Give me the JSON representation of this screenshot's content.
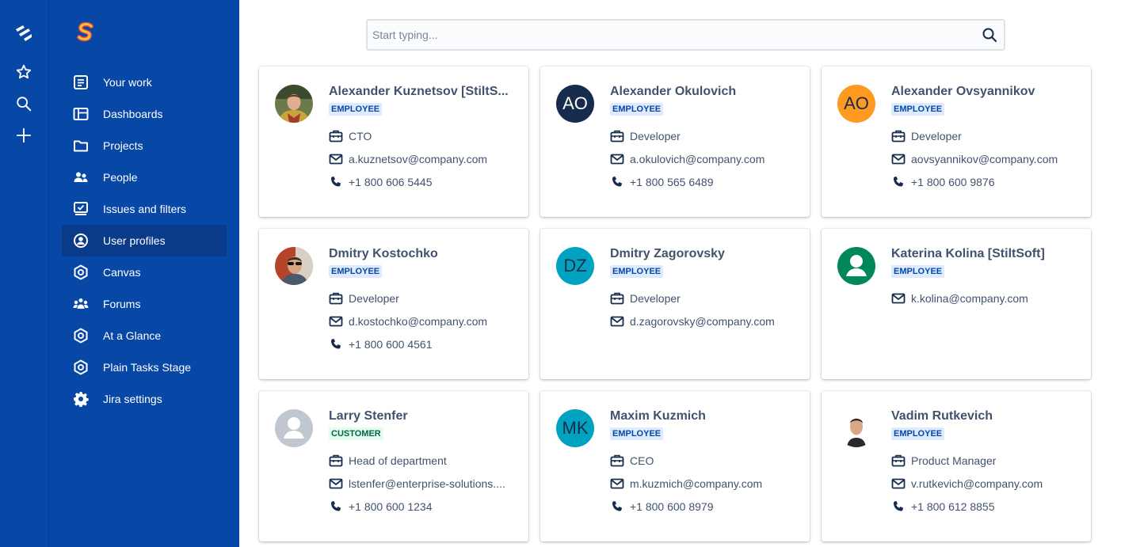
{
  "colors": {
    "brand_blue": "#0747a6",
    "active_nav": "#0a3a8a",
    "employee_badge_bg": "#deebff",
    "customer_badge_bg": "#e3fcef"
  },
  "rail": {
    "logo_icon": "jira-logo-icon",
    "starred_icon": "star-icon",
    "search_icon": "search-icon",
    "create_icon": "plus-icon"
  },
  "sidebar": {
    "app_logo_icon": "stiltsoft-s-logo",
    "items": [
      {
        "label": "Your work",
        "icon": "your-work-icon"
      },
      {
        "label": "Dashboards",
        "icon": "dashboard-icon"
      },
      {
        "label": "Projects",
        "icon": "folder-icon"
      },
      {
        "label": "People",
        "icon": "people-icon"
      },
      {
        "label": "Issues and filters",
        "icon": "issues-icon"
      },
      {
        "label": "User profiles",
        "icon": "user-profile-icon",
        "active": true
      },
      {
        "label": "Canvas",
        "icon": "hexagon-icon"
      },
      {
        "label": "Forums",
        "icon": "forums-icon"
      },
      {
        "label": "At a Glance",
        "icon": "hexagon-icon"
      },
      {
        "label": "Plain Tasks Stage",
        "icon": "hexagon-icon"
      },
      {
        "label": "Jira settings",
        "icon": "gear-icon"
      }
    ]
  },
  "search": {
    "placeholder": "Start typing...",
    "value": ""
  },
  "cards": [
    {
      "name": "Alexander Kuznetsov [StiltS...",
      "badge": "EMPLOYEE",
      "role": "CTO",
      "email": "a.kuznetsov@company.com",
      "phone": "+1 800 606 5445",
      "avatar": "photo"
    },
    {
      "name": "Alexander Okulovich",
      "badge": "EMPLOYEE",
      "role": "Developer",
      "email": "a.okulovich@company.com",
      "phone": "+1 800 565 6489",
      "avatar": "AO",
      "avatar_color": "#172b4d",
      "avatar_text_color": "#ffffff"
    },
    {
      "name": "Alexander Ovsyannikov",
      "badge": "EMPLOYEE",
      "role": "Developer",
      "email": "aovsyannikov@company.com",
      "phone": "+1 800 600 9876",
      "avatar": "AO",
      "avatar_color": "#ff991f",
      "avatar_text_color": "#172b4d"
    },
    {
      "name": "Dmitry Kostochko",
      "badge": "EMPLOYEE",
      "role": "Developer",
      "email": "d.kostochko@company.com",
      "phone": "+1 800 600 4561",
      "avatar": "photo"
    },
    {
      "name": "Dmitry Zagorovsky",
      "badge": "EMPLOYEE",
      "role": "Developer",
      "email": "d.zagorovsky@company.com",
      "phone": "",
      "avatar": "DZ",
      "avatar_color": "#00a3bf",
      "avatar_text_color": "#172b4d"
    },
    {
      "name": "Katerina Kolina [StiltSoft]",
      "badge": "EMPLOYEE",
      "role": "",
      "email": "k.kolina@company.com",
      "phone": "",
      "avatar": "default",
      "avatar_color": "#00875a"
    },
    {
      "name": "Larry Stenfer",
      "badge": "CUSTOMER",
      "role": "Head of department",
      "email": "lstenfer@enterprise-solutions....",
      "phone": "+1 800 600 1234",
      "avatar": "default",
      "avatar_color": "#c1c7d0"
    },
    {
      "name": "Maxim Kuzmich",
      "badge": "EMPLOYEE",
      "role": "CEO",
      "email": "m.kuzmich@company.com",
      "phone": "+1 800 600 8979",
      "avatar": "MK",
      "avatar_color": "#00a3bf",
      "avatar_text_color": "#172b4d"
    },
    {
      "name": "Vadim Rutkevich",
      "badge": "EMPLOYEE",
      "role": "Product Manager",
      "email": "v.rutkevich@company.com",
      "phone": "+1 800 612 8855",
      "avatar": "photo"
    }
  ]
}
